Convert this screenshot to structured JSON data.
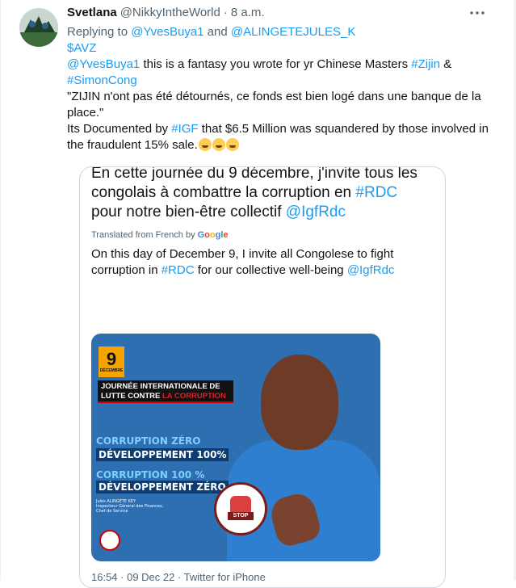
{
  "tweet": {
    "author_name": "Svetlana",
    "author_handle": "@NikkyIntheWorld",
    "separator": "·",
    "time": "8 a.m.",
    "more_label": "···",
    "reply": {
      "prefix": "Replying to",
      "to_1": "@YvesBuya1",
      "joiner": "and",
      "to_2": "@ALINGETEJULES_K"
    },
    "cashtag": "$AVZ",
    "body": {
      "mention": "@YvesBuya1",
      "text_1": " this is a fantasy you wrote for yr Chinese Masters ",
      "tag_zijin": "#Zijin",
      "amp": " &",
      "tag_simon": "#SimonCong",
      "quote": "\"ZIJIN n'ont pas été détournés, ce fonds est bien logé dans une banque de la place.\"",
      "text_2": "Its Documented by ",
      "tag_igf": "#IGF",
      "text_3": " that $6.5 Million was squandered by those involved in the fraudulent 15% sale."
    }
  },
  "quoted": {
    "fr_1": "En cette journée du 9 décembre, j'invite tous les congolais à combattre la corruption en ",
    "fr_tag": "#RDC",
    "fr_2": " pour notre bien-être collectif ",
    "fr_mention": "@IgfRdc",
    "translated_label": "Translated from French by",
    "google": [
      "G",
      "o",
      "o",
      "g",
      "l",
      "e"
    ],
    "en_1": "On this day of December 9, I invite all Congolese to fight corruption in ",
    "en_tag": "#RDC",
    "en_2": " for our collective well-being ",
    "en_mention": "@IgfRdc",
    "footer": "16:54 · 09 Dec 22 · Twitter for iPhone"
  },
  "poster": {
    "day": "9",
    "month": "DÉCEMBRE",
    "banner_1": "JOURNÉE INTERNATIONALE DE",
    "banner_2": "LUTTE CONTRE ",
    "banner_red": "LA CORRUPTION",
    "line_1": "CORRUPTION ZÉRO",
    "line_2": "DÉVELOPPEMENT 100%",
    "line_3": "CORRUPTION 100 %",
    "line_4": "DÉVELOPPEMENT ZÉRO",
    "signer": "Jules ALINGETE KEY",
    "signer_title": "Inspecteur Général des Finances, Chef de Service",
    "stamp_text": "STOP"
  },
  "colors": {
    "link": "#1d9bf0",
    "text": "#0f1419",
    "muted": "#536471",
    "border": "#cfd9de"
  }
}
